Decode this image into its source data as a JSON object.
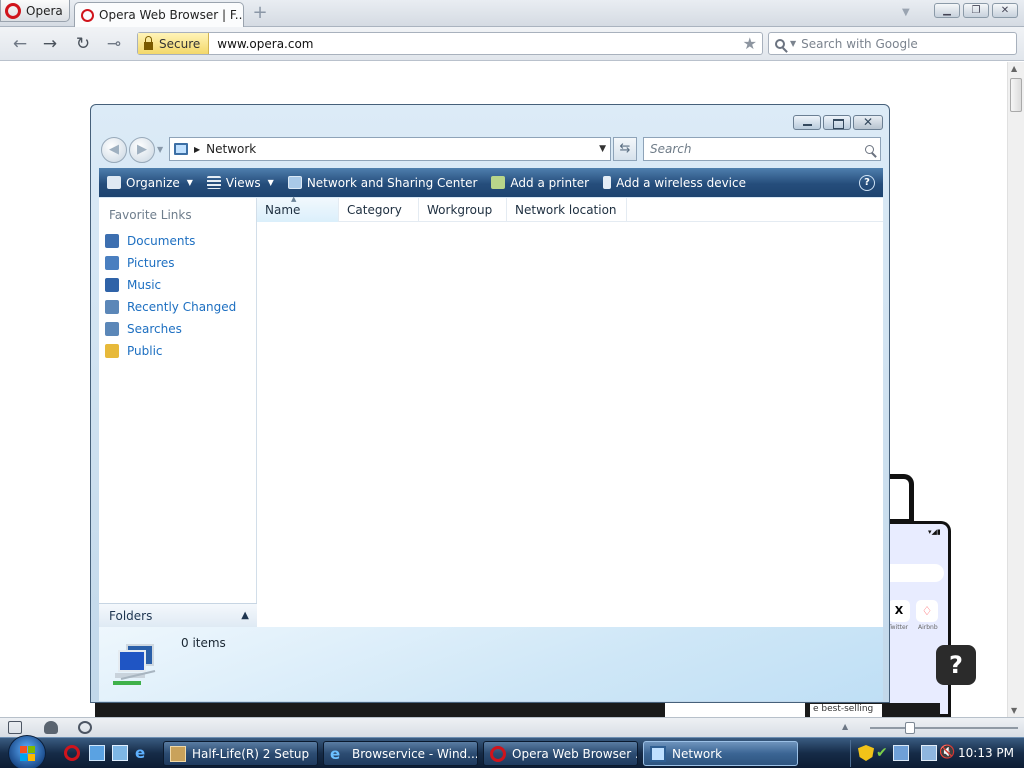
{
  "browser": {
    "menu_label": "Opera",
    "tab": {
      "title": "Opera Web Browser | F...",
      "close": "✕",
      "new_tab": "+"
    },
    "address": {
      "secure_label": "Secure",
      "url": "www.opera.com"
    },
    "search": {
      "placeholder": "Search with Google"
    }
  },
  "background_page": {
    "help_button": "?",
    "phone_labels": [
      "Twitter",
      "Airbnb"
    ],
    "snippet": "e best-selling"
  },
  "explorer": {
    "breadcrumb": {
      "location": "Network"
    },
    "search": {
      "placeholder": "Search"
    },
    "commands": [
      {
        "label": "Organize",
        "has_dropdown": true,
        "icon": "organize-icon"
      },
      {
        "label": "Views",
        "has_dropdown": true,
        "icon": "views-icon"
      },
      {
        "label": "Network and Sharing Center",
        "has_dropdown": false,
        "icon": "network-center-icon"
      },
      {
        "label": "Add a printer",
        "has_dropdown": false,
        "icon": "printer-icon"
      },
      {
        "label": "Add a wireless device",
        "has_dropdown": false,
        "icon": "wireless-icon"
      }
    ],
    "help": "?",
    "favorite_links": {
      "title": "Favorite Links",
      "items": [
        {
          "label": "Documents",
          "icon": "documents-icon",
          "color": "#3d6fb0"
        },
        {
          "label": "Pictures",
          "icon": "pictures-icon",
          "color": "#4a7fc0"
        },
        {
          "label": "Music",
          "icon": "music-icon",
          "color": "#2f63a8"
        },
        {
          "label": "Recently Changed",
          "icon": "recent-icon",
          "color": "#5b87b8"
        },
        {
          "label": "Searches",
          "icon": "searches-icon",
          "color": "#5b87b8"
        },
        {
          "label": "Public",
          "icon": "folder-icon",
          "color": "#e7b93a"
        }
      ]
    },
    "folders_label": "Folders",
    "columns": [
      "Name",
      "Category",
      "Workgroup",
      "Network location"
    ],
    "status": "0 items"
  },
  "statusbar": {},
  "taskbar": {
    "tasks": [
      {
        "label": "Half-Life(R) 2 Setup",
        "icon": "halflife-icon",
        "active": false
      },
      {
        "label": "Browservice - Wind...",
        "icon": "ie-icon",
        "active": false
      },
      {
        "label": "Opera Web Browser ...",
        "icon": "opera-icon",
        "active": false
      },
      {
        "label": "Network",
        "icon": "network-icon",
        "active": true
      }
    ],
    "clock": "10:13 PM"
  }
}
